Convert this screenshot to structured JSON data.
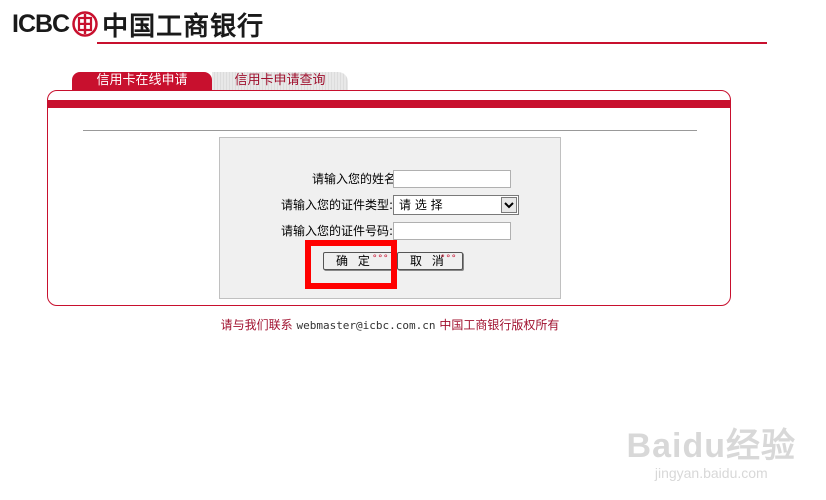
{
  "header": {
    "logo_en": "ICBC",
    "logo_cn": "中国工商银行",
    "brand_color": "#c8102e"
  },
  "tabs": [
    {
      "label": "信用卡在线申请",
      "active": true
    },
    {
      "label": "信用卡申请查询",
      "active": false
    }
  ],
  "form": {
    "name_label": "请输入您的姓名:",
    "name_value": "",
    "id_type_label": "请输入您的证件类型:",
    "id_type_selected": "请 选 择",
    "id_number_label": "请输入您的证件号码:",
    "id_number_value": "",
    "confirm_label": "确 定",
    "cancel_label": "取 消",
    "button_dots": "°°°"
  },
  "footer": {
    "contact_text": "请与我们联系",
    "email": "webmaster@icbc.com.cn",
    "copyright": "中国工商银行版权所有"
  },
  "watermark": {
    "logo": "Baidu经验",
    "url": "jingyan.baidu.com"
  }
}
